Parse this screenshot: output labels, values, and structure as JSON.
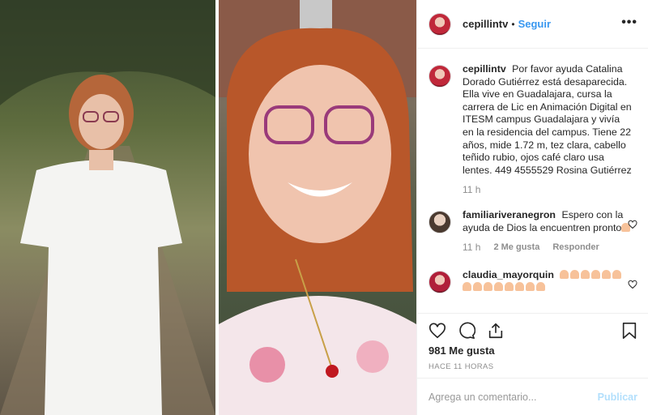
{
  "post": {
    "username": "cepillintv",
    "follow_label": "Seguir",
    "more_label": "•••",
    "dot": "•"
  },
  "comments": [
    {
      "username": "cepillintv",
      "text": "Por favor ayuda Catalina Dorado Gutiérrez está desaparecida. Ella vive en Guadalajara, cursa la carrera de Lic en Animación Digital en ITESM campus Guadalajara y vivía en la residencia del campus. Tiene 22 años, mide 1.72 m, tez clara, cabello teñido rubio, ojos café claro usa lentes. 449 4555529 Rosina Gutiérrez",
      "time": "11 h"
    },
    {
      "username": "familiariveranegron",
      "text": "Espero con la ayuda de Dios la encuentren pronto",
      "time": "11 h",
      "likes_label": "2 Me gusta",
      "reply_label": "Responder"
    },
    {
      "username": "claudia_mayorquin",
      "pray_count_line1": 6,
      "pray_count_line2": 8
    }
  ],
  "actions": {
    "likes": "981 Me gusta",
    "timestamp": "HACE 11 HORAS",
    "icons": [
      "heart-icon",
      "comment-icon",
      "share-icon",
      "bookmark-icon"
    ]
  },
  "add_comment": {
    "placeholder": "Agrega un comentario...",
    "publish_label": "Publicar"
  },
  "colors": {
    "accent": "#3897f0",
    "publish_disabled": "#b2dffc",
    "muted": "#8e8e8e"
  }
}
